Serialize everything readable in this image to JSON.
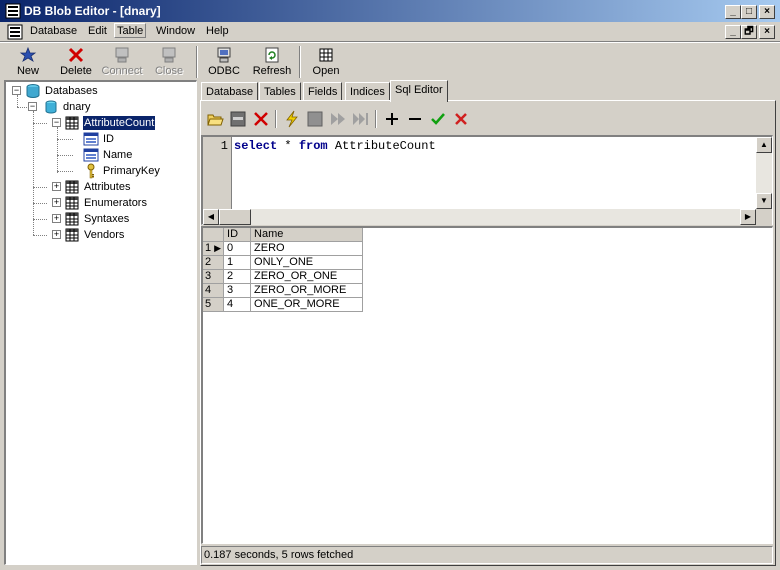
{
  "window": {
    "title": "DB Blob Editor - [dnary]",
    "controls": {
      "minimize": "_",
      "maximize": "□",
      "close": "×",
      "restore": "🗗"
    }
  },
  "menubar": {
    "items": [
      "Database",
      "Edit",
      "Table",
      "Window",
      "Help"
    ]
  },
  "toolbar": {
    "new": "New",
    "delete": "Delete",
    "connect": "Connect",
    "close": "Close",
    "odbc": "ODBC",
    "refresh": "Refresh",
    "open": "Open"
  },
  "tree": {
    "root": "Databases",
    "database": "dnary",
    "tables": [
      {
        "name": "AttributeCount",
        "expanded": true,
        "selected": true,
        "children": [
          "ID",
          "Name",
          "PrimaryKey"
        ]
      },
      {
        "name": "Attributes",
        "expanded": false
      },
      {
        "name": "Enumerators",
        "expanded": false
      },
      {
        "name": "Syntaxes",
        "expanded": false
      },
      {
        "name": "Vendors",
        "expanded": false
      }
    ]
  },
  "tabs": [
    "Database",
    "Tables",
    "Fields",
    "Indices",
    "Sql Editor"
  ],
  "active_tab": "Sql Editor",
  "editor": {
    "line_number": "1",
    "kw_select": "select",
    "star": "*",
    "kw_from": "from",
    "table": "AttributeCount"
  },
  "grid": {
    "columns": [
      "ID",
      "Name"
    ],
    "rows": [
      {
        "num": "1",
        "id": "0",
        "name": "ZERO"
      },
      {
        "num": "2",
        "id": "1",
        "name": "ONLY_ONE"
      },
      {
        "num": "3",
        "id": "2",
        "name": "ZERO_OR_ONE"
      },
      {
        "num": "4",
        "id": "3",
        "name": "ZERO_OR_MORE"
      },
      {
        "num": "5",
        "id": "4",
        "name": "ONE_OR_MORE"
      }
    ]
  },
  "status": "0.187 seconds,  5 rows fetched",
  "colors": {
    "titlebar_start": "#0a246a",
    "titlebar_end": "#a6caf0",
    "keyword": "#00008b",
    "selection": "#0a246a"
  }
}
